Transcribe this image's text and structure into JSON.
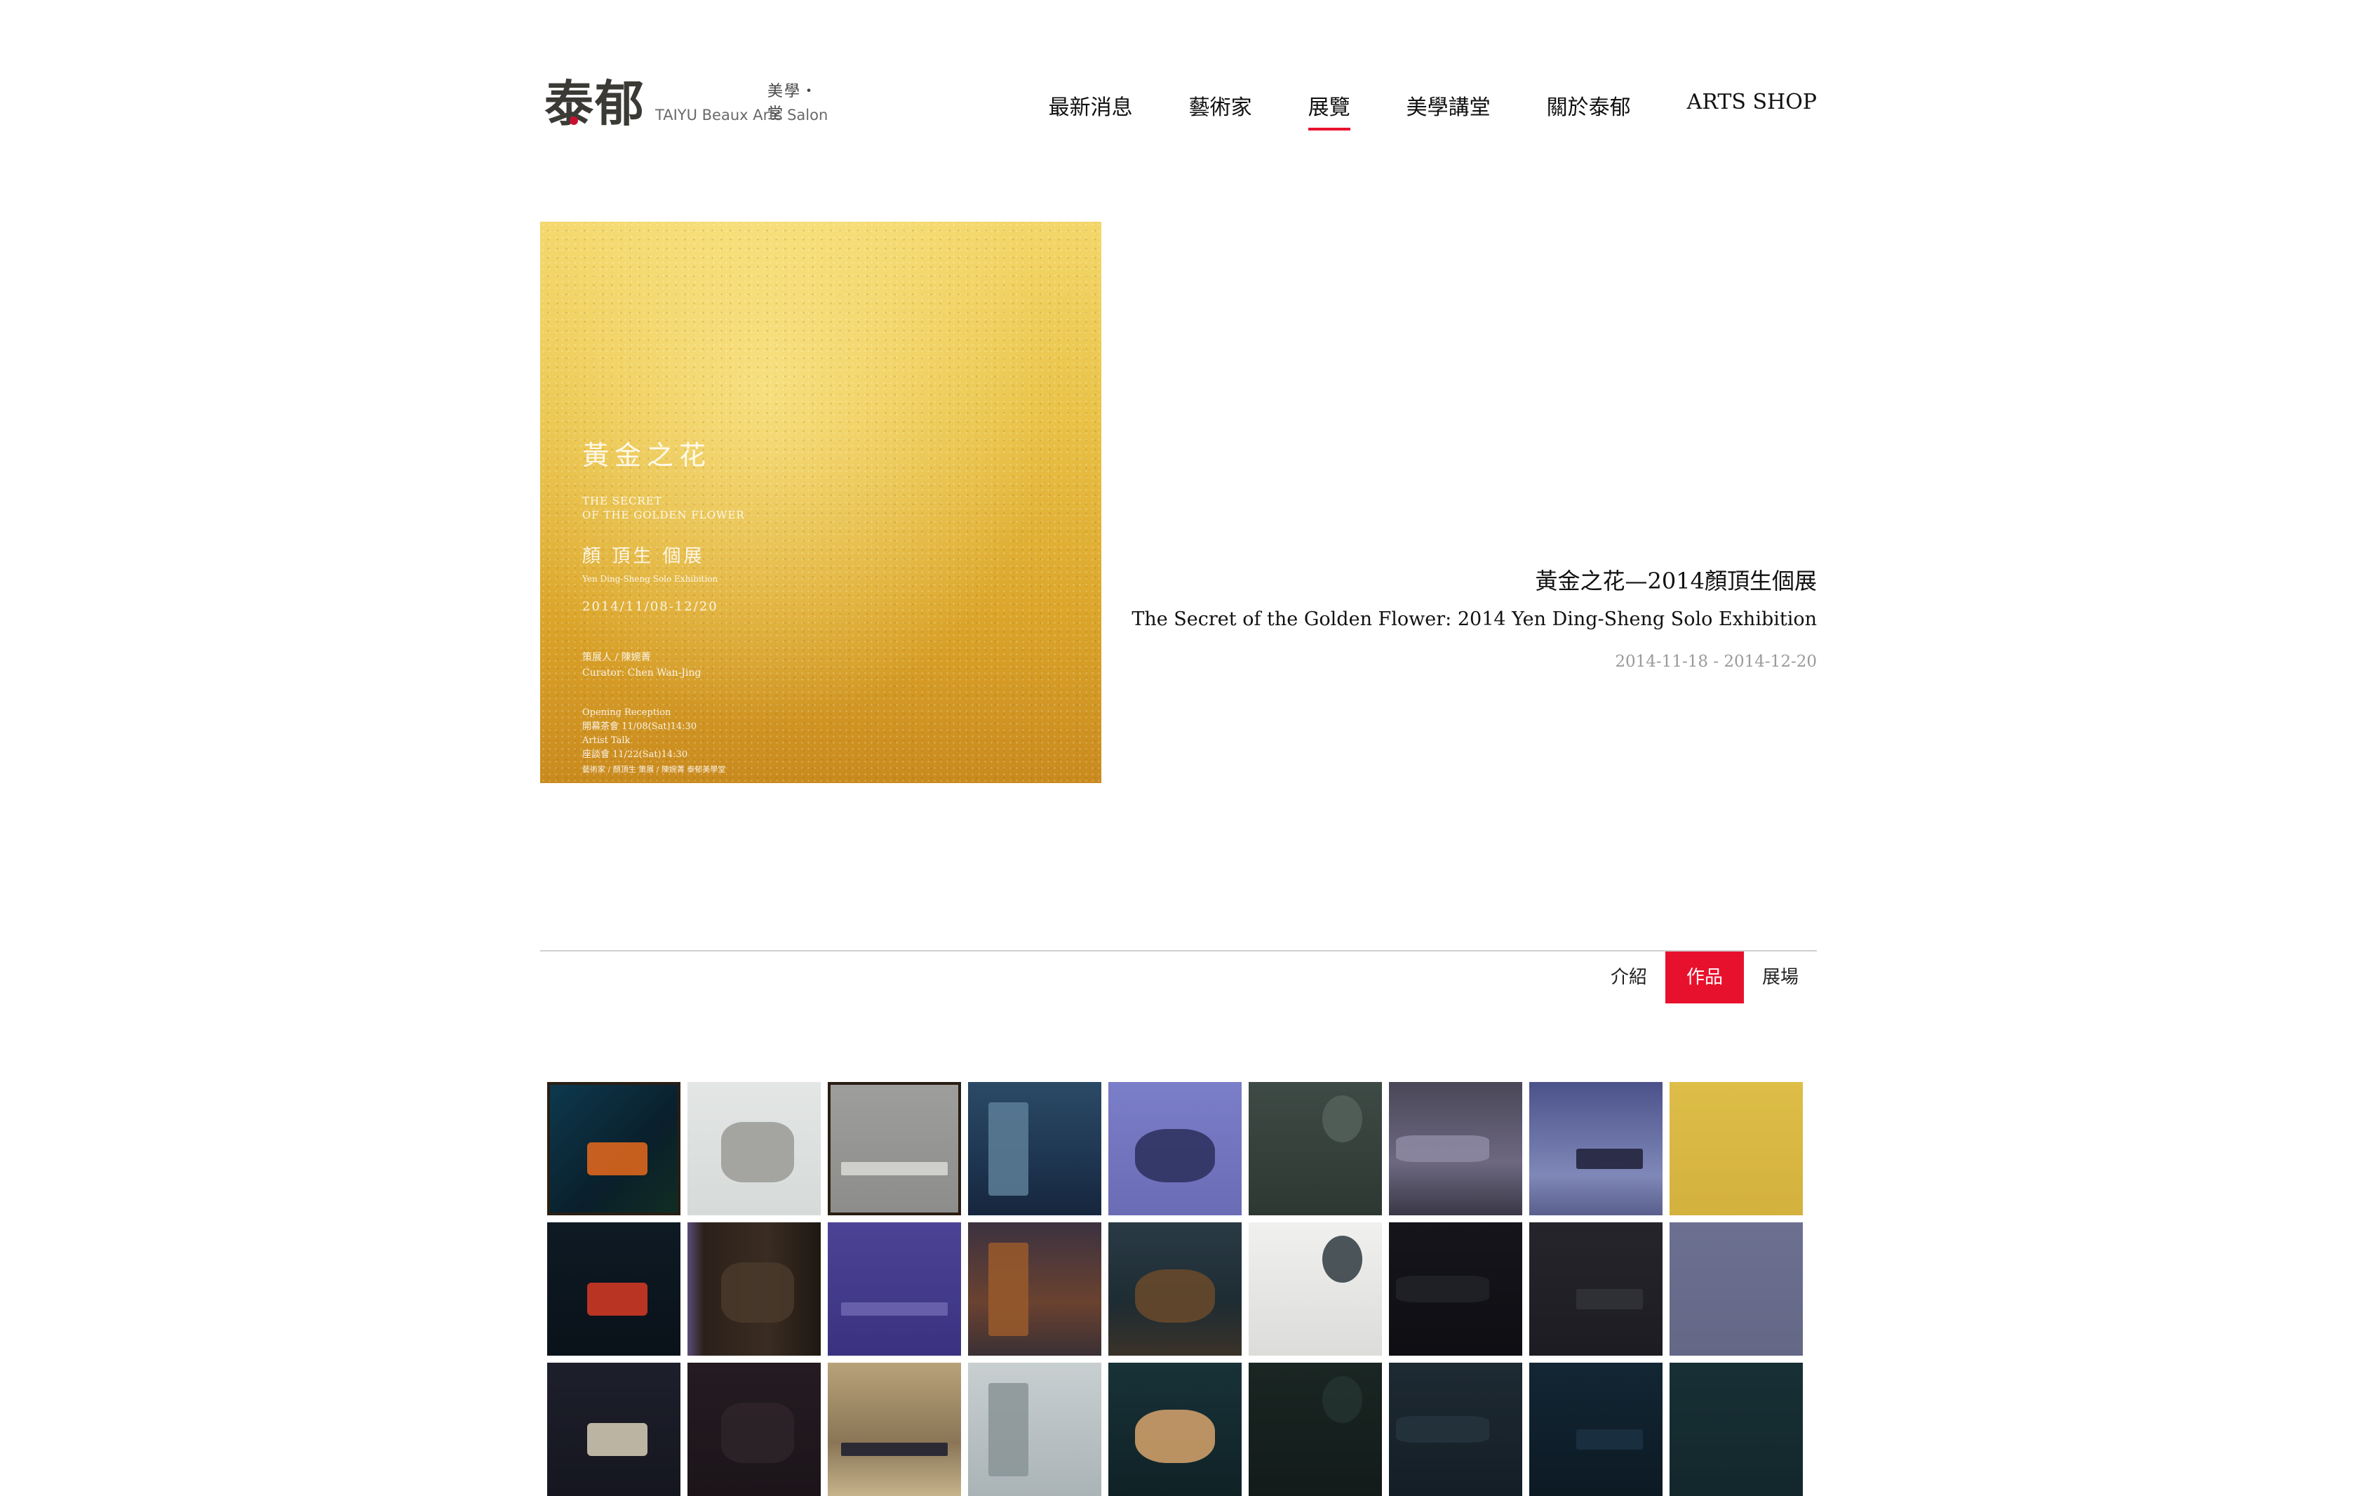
{
  "brand": {
    "logo_cn": "泰郁",
    "logo_sub_cn": "美學・堂",
    "logo_sub_en": "TAIYU Beaux Arts Salon"
  },
  "nav": {
    "items": [
      {
        "label": "最新消息"
      },
      {
        "label": "藝術家"
      },
      {
        "label": "展覽",
        "active": true
      },
      {
        "label": "美學講堂"
      },
      {
        "label": "關於泰郁"
      },
      {
        "label": "ARTS SHOP"
      }
    ],
    "active_color": "#e8112d"
  },
  "poster": {
    "title_cn": "黃金之花",
    "title_en_line1": "THE SECRET",
    "title_en_line2": "OF THE GOLDEN FLOWER",
    "artist_cn": "顏 頂生 個展",
    "artist_en": "Yen Ding-Sheng Solo Exhibition",
    "dates": "2014/11/08-12/20",
    "curator_cn": "策展人 / 陳婉菁",
    "curator_en": "Curator: Chen Wan-Jing",
    "opening_en": "Opening Reception",
    "opening_cn": "開幕茶會 11/08(Sat)14:30",
    "talk_en": "Artist Talk",
    "talk_cn": "座談會 11/22(Sat)14:30",
    "footer": "藝術家 / 顏頂生  策展 / 陳婉菁  泰郁美學堂"
  },
  "exhibition": {
    "title_cn": "黃金之花—2014顏頂生個展",
    "title_en": "The Secret of the Golden Flower: 2014 Yen Ding-Sheng Solo Exhibition",
    "date_range": "2014-11-18 - 2014-12-20"
  },
  "tabs": [
    {
      "label": "介紹"
    },
    {
      "label": "作品",
      "active": true
    },
    {
      "label": "展場"
    }
  ],
  "artworks": [
    {
      "bg": "linear-gradient(135deg,#0d3a4f 0%,#0a1f2b 60%,#112d22 100%)",
      "mark": "#e86a1c",
      "frame": true
    },
    {
      "bg": "linear-gradient(180deg,#e3e6e5 0%,#d6dad9 100%)",
      "mark": "#9a9a95"
    },
    {
      "bg": "linear-gradient(180deg,#9e9f9c 0%,#8c8d8a 100%)",
      "mark": "#d9d9d6",
      "frame": true
    },
    {
      "bg": "linear-gradient(180deg,#2b4a66 0%,#1e3550 60%,#16263d 100%)",
      "mark": "#5d7e98"
    },
    {
      "bg": "linear-gradient(180deg,#7b7ec8 0%,#6a6cb5 100%)",
      "mark": "#2a2f5c"
    },
    {
      "bg": "linear-gradient(180deg,#3e4a45 0%,#2e3833 100%)",
      "mark": "#55615b"
    },
    {
      "bg": "linear-gradient(180deg,#4a4758 0%,#6d6880 60%,#3a3847 100%)",
      "mark": "#8e89a3"
    },
    {
      "bg": "linear-gradient(180deg,#4b528a 0%,#7f88b8 70%,#5a5f8c 100%)",
      "mark": "#1e2037"
    },
    {
      "bg": "linear-gradient(180deg,#d8b53a 0%,#c9a22b 100%)",
      "mark": "#e9cf62"
    },
    {
      "bg": "linear-gradient(180deg,#0e1a24 0%,#0a1219 100%)",
      "mark": "#d93a25"
    },
    {
      "bg": "linear-gradient(90deg,#5b4d78 0%,#2b211a 12%,#3a2c22 60%,#1e1812 100%)",
      "mark": "#4a3a2c"
    },
    {
      "bg": "linear-gradient(180deg,#4d4396 0%,#3a3280 100%)",
      "mark": "#7066b0"
    },
    {
      "bg": "linear-gradient(180deg,#3c3240 0%,#6a4230 60%,#3b3034 100%)",
      "mark": "#9a5a2c"
    },
    {
      "bg": "linear-gradient(180deg,#2a3a45 0%,#1e2c33 60%,#3a3228 100%)",
      "mark": "#6a4a2a"
    },
    {
      "bg": "linear-gradient(180deg,#f0f0ee 0%,#dcdcda 100%)",
      "mark": "#2e3a40"
    },
    {
      "bg": "linear-gradient(180deg,#15151b 0%,#0e0e13 100%)",
      "mark": "#222229"
    },
    {
      "bg": "linear-gradient(180deg,#25252b 0%,#1c1c22 100%)",
      "mark": "#33333a"
    },
    {
      "bg": "linear-gradient(180deg,#3c4170 0%,#2f3460 100%)",
      "mark": "#c8c9cf"
    },
    {
      "bg": "linear-gradient(180deg,#1d1f2b 0%,#15161f 100%)",
      "mark": "#d8d0b8"
    },
    {
      "bg": "linear-gradient(180deg,#241c22 0%,#1b1419 100%)",
      "mark": "#2e242a"
    },
    {
      "bg": "linear-gradient(180deg,#b8a27a 0%,#8a7656 60%,#c6b38c 100%)",
      "mark": "#1a1c2e"
    },
    {
      "bg": "linear-gradient(180deg,#c8cfd1 0%,#aab3b6 100%)",
      "mark": "#8a9497"
    },
    {
      "bg": "linear-gradient(180deg,#183238 0%,#0f2226 100%)",
      "mark": "#d8a46c"
    },
    {
      "bg": "linear-gradient(180deg,#1a2623 0%,#121b19 100%)",
      "mark": "#243330"
    },
    {
      "bg": "linear-gradient(180deg,#1e2a33 0%,#141e26 100%)",
      "mark": "#26343e"
    },
    {
      "bg": "linear-gradient(180deg,#132634 0%,#0c1a24 100%)",
      "mark": "#1b3142"
    },
    {
      "bg": "linear-gradient(180deg,#152b30 0%,#0e1f23 100%)",
      "mark": "#1d3a40"
    }
  ]
}
